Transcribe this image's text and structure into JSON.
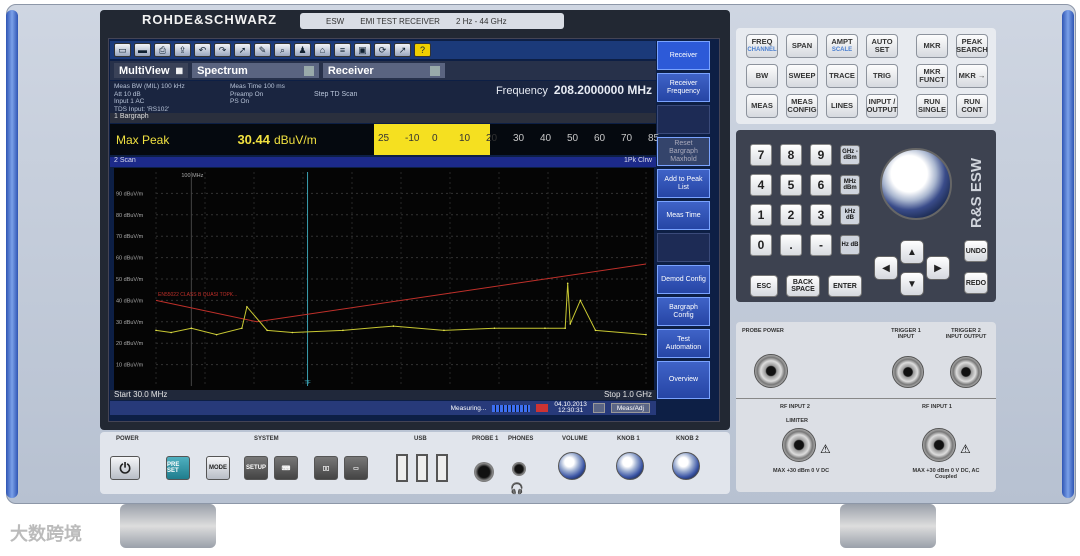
{
  "brand": "ROHDE&SCHWARZ",
  "model_plate": [
    "ESW",
    "EMI TEST RECEIVER",
    "2 Hz - 44 GHz"
  ],
  "toolbar_icons": [
    "folder-icon",
    "save-icon",
    "print-icon",
    "usb-icon",
    "undo-icon",
    "redo-icon",
    "pointer-icon",
    "marker-icon",
    "zoom-icon",
    "person-icon",
    "home-icon",
    "list-icon",
    "screen-icon",
    "cycle-icon",
    "share-icon",
    "help-icon"
  ],
  "tabs": {
    "multiview": "MultiView",
    "spectrum": "Spectrum",
    "receiver": "Receiver"
  },
  "info": {
    "col1": [
      "Meas BW  (MIL) 100 kHz",
      "Att                    10 dB",
      "Input                  1 AC",
      "TDS Input: 'RS102'"
    ],
    "col2": [
      "Meas Time  100 ms",
      "Preamp           On",
      "PS                    On"
    ],
    "col3": "Step TD Scan",
    "freq_label": "Frequency",
    "freq_value": "208.2000000 MHz"
  },
  "bargraph": {
    "header": "1 Bargraph",
    "label": "Max Peak",
    "value": "30.44",
    "unit": "dBuV/m",
    "scale": [
      "25",
      "-10",
      "0",
      "10",
      "20",
      "30",
      "40",
      "50",
      "60",
      "70",
      "85"
    ],
    "fill_fraction": 0.41
  },
  "scan": {
    "header": "2 Scan",
    "trace_tag": "1Pk Clrw",
    "marker_label": "100 MHz",
    "limit_label": "EN55022 CLASS B QUASI TOPK...",
    "tf_label": "TF"
  },
  "chart_data": {
    "type": "line",
    "ylabel": "dBuV/m",
    "y_ticks": [
      "90 dBuV/m",
      "80 dBuV/m",
      "70 dBuV/m",
      "60 dBuV/m",
      "50 dBuV/m",
      "40 dBuV/m",
      "30 dBuV/m",
      "20 dBuV/m",
      "10 dBuV/m"
    ],
    "ylim": [
      0,
      100
    ],
    "xlim_mhz": [
      30,
      1000
    ],
    "x_start": "Start 30.0 MHz",
    "x_stop": "Stop 1.0 GHz",
    "series": [
      {
        "x": [
          30,
          60,
          100,
          150,
          200,
          210,
          250,
          300,
          400,
          500,
          600,
          700,
          800,
          840,
          845,
          850,
          870,
          900,
          1000
        ],
        "y": [
          26,
          25,
          27,
          24,
          27,
          37,
          26,
          25,
          26,
          28,
          26,
          27,
          27,
          27,
          48,
          29,
          40,
          26,
          24
        ]
      }
    ],
    "limit_line": {
      "x": [
        30,
        230,
        1000
      ],
      "y": [
        40,
        30,
        57
      ]
    }
  },
  "status": {
    "start": "Start 30.0 MHz",
    "stop": "Stop 1.0 GHz",
    "measuring": "Measuring...",
    "date": "04.10.2013",
    "time": "12:30:31",
    "btn": "Meas/Adj"
  },
  "softkeys": [
    "Receiver",
    "Receiver Frequency",
    "",
    "Reset Bargraph Maxhold",
    "Add to Peak List",
    "Meas Time",
    "",
    "Demod Config",
    "Bargraph Config",
    "Test Automation",
    "Overview"
  ],
  "keys_top": [
    [
      {
        "l": "FREQ",
        "s": "CHANNEL"
      },
      {
        "l": "SPAN",
        "s": ""
      },
      {
        "l": "AMPT",
        "s": "SCALE"
      },
      {
        "l": "AUTO SET",
        "s": ""
      },
      {
        "l": "MKR",
        "s": ""
      },
      {
        "l": "PEAK SEARCH",
        "s": ""
      }
    ],
    [
      {
        "l": "BW",
        "s": ""
      },
      {
        "l": "SWEEP",
        "s": ""
      },
      {
        "l": "TRACE",
        "s": ""
      },
      {
        "l": "TRIG",
        "s": ""
      },
      {
        "l": "MKR FUNCT",
        "s": ""
      },
      {
        "l": "MKR →",
        "s": ""
      }
    ],
    [
      {
        "l": "MEAS",
        "s": ""
      },
      {
        "l": "MEAS CONFIG",
        "s": ""
      },
      {
        "l": "LINES",
        "s": ""
      },
      {
        "l": "INPUT / OUTPUT",
        "s": ""
      },
      {
        "l": "RUN SINGLE",
        "s": ""
      },
      {
        "l": "RUN CONT",
        "s": ""
      }
    ]
  ],
  "numpad": [
    "7",
    "8",
    "9",
    "4",
    "5",
    "6",
    "1",
    "2",
    "3",
    "0",
    ".",
    "-"
  ],
  "unit_keys": [
    "GHz -dBm",
    "MHz dBm",
    "kHz dB",
    "Hz dB"
  ],
  "nav_keys": {
    "esc": "ESC",
    "back": "BACK SPACE",
    "enter": "ENTER",
    "undo": "UNDO",
    "redo": "REDO"
  },
  "rsw_logo": "R&S ESW",
  "ports": {
    "probe_power": "PROBE POWER",
    "trig1": "TRIGGER 1 INPUT",
    "trig2": "TRIGGER 2 INPUT OUTPUT",
    "rf2": "RF INPUT 2",
    "rf1": "RF INPUT 1",
    "limiter": "LIMITER",
    "rf2_spec": "MAX +30 dBm 0 V DC",
    "rf1_spec": "MAX +30 dBm 0 V DC, AC Coupled"
  },
  "front": {
    "power": "POWER",
    "system": "SYSTEM",
    "usb": "USB",
    "probe1": "PROBE 1",
    "phones": "PHONES",
    "volume": "VOLUME",
    "knob1": "KNOB 1",
    "knob2": "KNOB 2",
    "preset": "PRE SET",
    "mode": "MODE",
    "setup": "SETUP"
  },
  "watermark": "大数跨境"
}
